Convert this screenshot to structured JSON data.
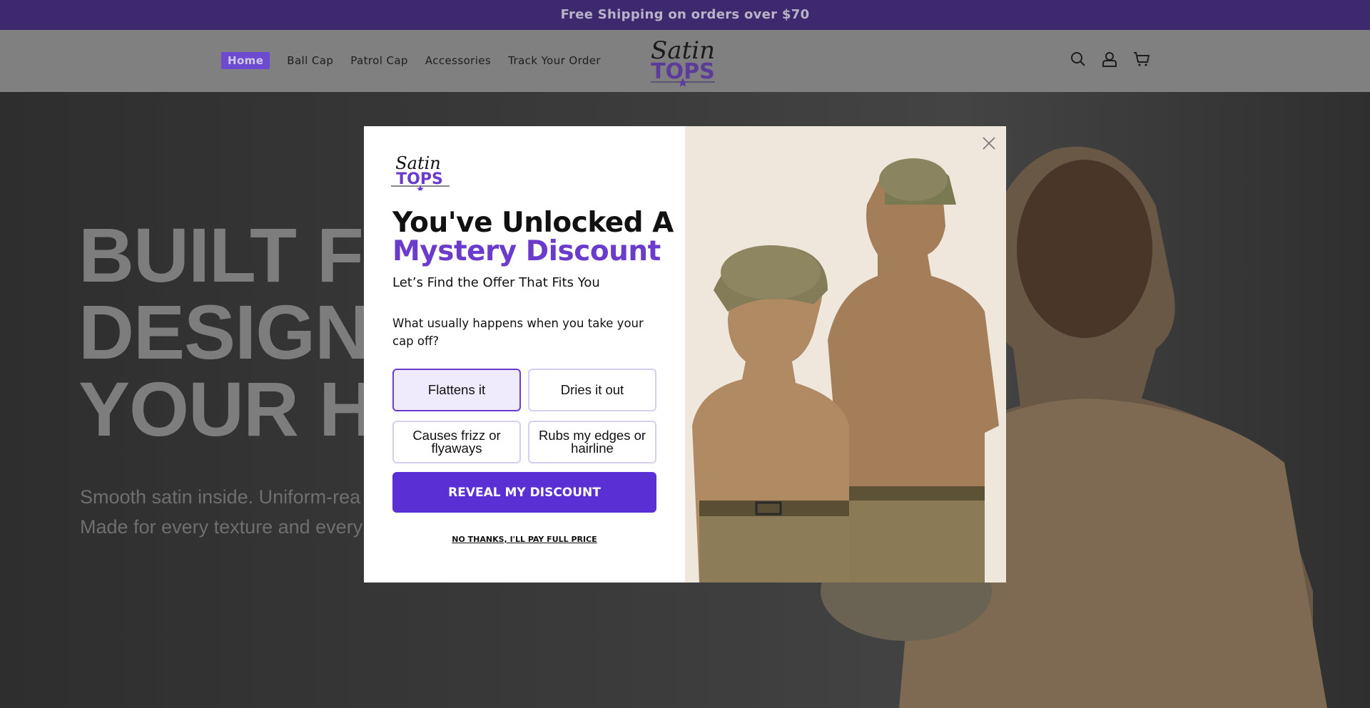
{
  "announcement": "Free Shipping on orders over $70",
  "nav": {
    "items": [
      "Home",
      "Ball Cap",
      "Patrol Cap",
      "Accessories",
      "Track Your Order"
    ]
  },
  "brand": {
    "line1": "Satin",
    "line2": "TOPS"
  },
  "header_icons": [
    "search-icon",
    "account-icon",
    "cart-icon"
  ],
  "hero": {
    "title_lines": [
      "BUILT FO",
      "DESIGNE",
      "YOUR HA"
    ],
    "sub_lines": [
      "Smooth satin inside. Uniform-rea",
      "Made for every texture and every"
    ]
  },
  "popup": {
    "heading_line1": "You've Unlocked A",
    "heading_line2": "Mystery Discount",
    "subheading": "Let’s Find the Offer That Fits You",
    "question": "What usually happens when you take your cap off?",
    "options": [
      "Flattens it",
      "Dries it out",
      "Causes frizz or flyaways",
      "Rubs my edges or hairline"
    ],
    "selected_option": "Flattens it",
    "cta": "REVEAL MY DISCOUNT",
    "decline": "NO THANKS, I'LL PAY FULL PRICE"
  },
  "colors": {
    "announcement_bg": "#3d2a6e",
    "brand_purple": "#6b3ccc",
    "cta_bg": "#5a2fd4",
    "option_border": "#d6cdef"
  }
}
